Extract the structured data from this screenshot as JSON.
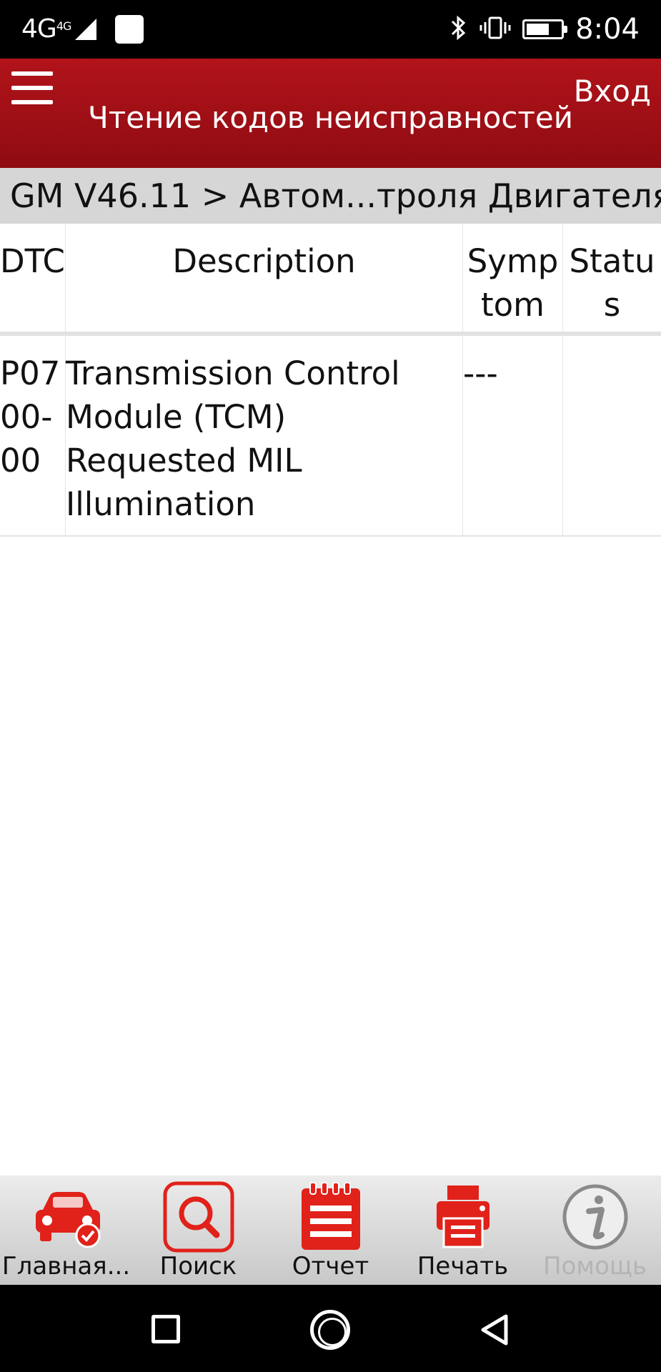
{
  "status_bar": {
    "network": "4G",
    "network_sup": "4G",
    "time": "8:04",
    "icons": [
      "signal-icon",
      "notification-icon",
      "bluetooth-icon",
      "vibrate-icon",
      "battery-icon"
    ]
  },
  "app_bar": {
    "title": "Чтение кодов неисправностей",
    "login_label": "Вход"
  },
  "breadcrumb": "GM V46.11 > Автом...троля Двигателя",
  "table": {
    "columns": [
      "DTC",
      "Description",
      "Symptom",
      "Status"
    ],
    "rows": [
      {
        "dtc": "P0700-00",
        "description": "Transmission Control Module (TCM) Requested MIL Illumination",
        "symptom": "---",
        "status": ""
      }
    ]
  },
  "toolbar": {
    "items": [
      {
        "label": "Главная...",
        "icon": "car-check-icon",
        "enabled": true
      },
      {
        "label": "Поиск",
        "icon": "search-icon",
        "enabled": true
      },
      {
        "label": "Отчет",
        "icon": "report-icon",
        "enabled": true
      },
      {
        "label": "Печать",
        "icon": "printer-icon",
        "enabled": true
      },
      {
        "label": "Помощь",
        "icon": "info-icon",
        "enabled": false
      }
    ]
  },
  "colors": {
    "accent": "#a5111a",
    "icon_red": "#e0221a",
    "disabled": "#b4b4b4"
  }
}
